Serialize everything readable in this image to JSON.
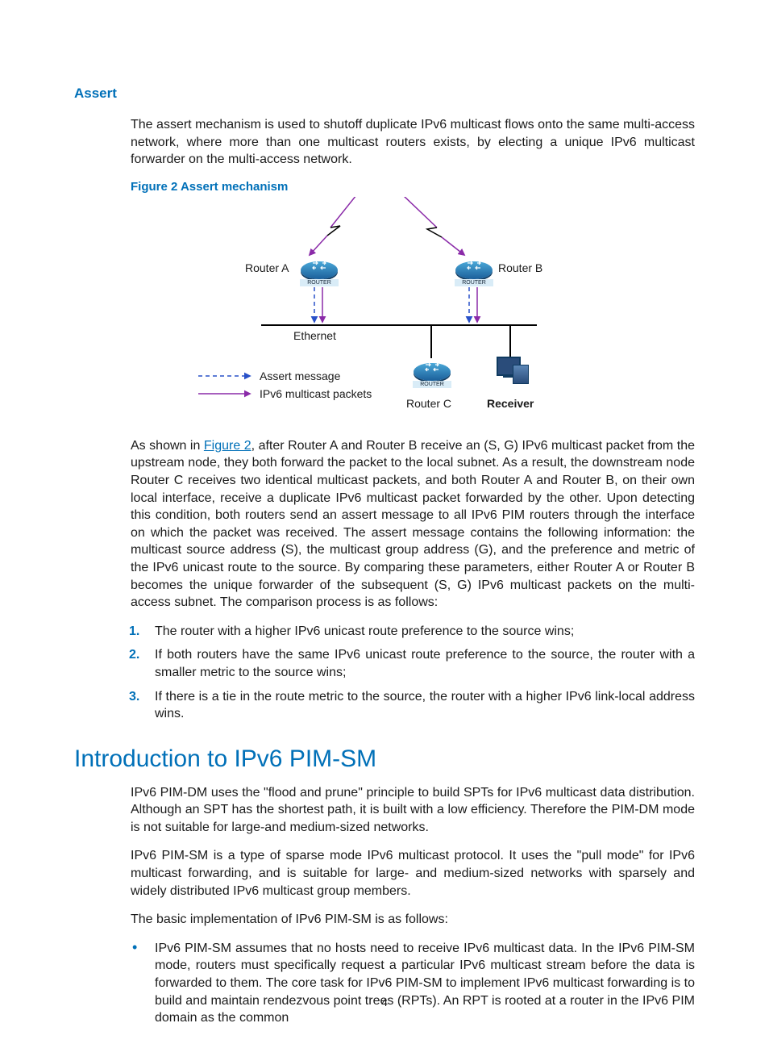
{
  "h3_assert": "Assert",
  "p_assert_intro": "The assert mechanism is used to shutoff duplicate IPv6 multicast flows onto the same multi-access network, where more than one multicast routers exists, by electing a unique IPv6 multicast forwarder on the multi-access network.",
  "figcap": "Figure 2 Assert mechanism",
  "diagram": {
    "router_a": "Router A",
    "router_b": "Router B",
    "router_c": "Router C",
    "ethernet": "Ethernet",
    "receiver": "Receiver",
    "legend_assert": "Assert message",
    "legend_mcast": "IPv6 multicast packets"
  },
  "p_after_fig_pre": "As shown in ",
  "figref_text": "Figure 2",
  "p_after_fig_post": ", after Router A and Router B receive an (S, G) IPv6 multicast packet from the upstream node, they both forward the packet to the local subnet. As a result, the downstream node Router C receives two identical multicast packets, and both Router A and Router B, on their own local interface, receive a duplicate IPv6 multicast packet forwarded by the other. Upon detecting this condition, both routers send an assert message to all IPv6 PIM routers through the interface on which the packet was received. The assert message contains the following information: the multicast source address (S), the multicast group address (G), and the preference and metric of the IPv6 unicast route to the source. By comparing these parameters, either Router A or Router B becomes the unique forwarder of the subsequent (S, G) IPv6 multicast packets on the multi-access subnet. The comparison process is as follows:",
  "ol_items": [
    "The router with a higher IPv6 unicast route preference to the source wins;",
    "If both routers have the same IPv6 unicast route preference to the source, the router with a smaller metric to the source wins;",
    "If there is a tie in the route metric to the source, the router with a higher IPv6 link-local address wins."
  ],
  "h2_pimsm": "Introduction to IPv6 PIM-SM",
  "p_pimsm_1": "IPv6 PIM-DM uses the \"flood and prune\" principle to build SPTs for IPv6 multicast data distribution. Although an SPT has the shortest path, it is built with a low efficiency. Therefore the PIM-DM mode is not suitable for large-and medium-sized networks.",
  "p_pimsm_2": "IPv6 PIM-SM is a type of sparse mode IPv6 multicast protocol. It uses the \"pull mode\" for IPv6 multicast forwarding, and is suitable for large- and medium-sized networks with sparsely and widely distributed IPv6 multicast group members.",
  "p_pimsm_3": "The basic implementation of IPv6 PIM-SM is as follows:",
  "ul_pimsm": [
    "IPv6 PIM-SM assumes that no hosts need to receive IPv6 multicast data. In the IPv6 PIM-SM mode, routers must specifically request a particular IPv6 multicast stream before the data is forwarded to them. The core task for IPv6 PIM-SM to implement IPv6 multicast forwarding is to build and maintain rendezvous point trees (RPTs). An RPT is rooted at a router in the IPv6 PIM domain as the common"
  ],
  "page_number": "4"
}
